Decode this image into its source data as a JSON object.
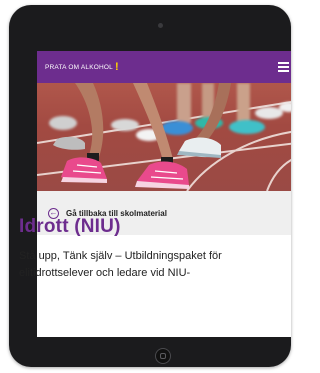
{
  "header": {
    "logo_text": "PRATA OM ALKOHOL",
    "logo_mark": "!"
  },
  "back_link": {
    "label": "Gå tillbaka till skolmaterial"
  },
  "article": {
    "title": "Idrott (NIU)",
    "intro": "Stå upp, Tänk själv – Utbildningspaket för elitidrottselever och ledare vid NIU-"
  },
  "colors": {
    "brand_purple": "#6d2d8e",
    "logo_accent": "#ffd400",
    "back_bar": "#efefef",
    "device": "#1b1b1d"
  },
  "icons": {
    "menu": "hamburger-menu-icon",
    "back": "arrow-left-circle-icon"
  }
}
